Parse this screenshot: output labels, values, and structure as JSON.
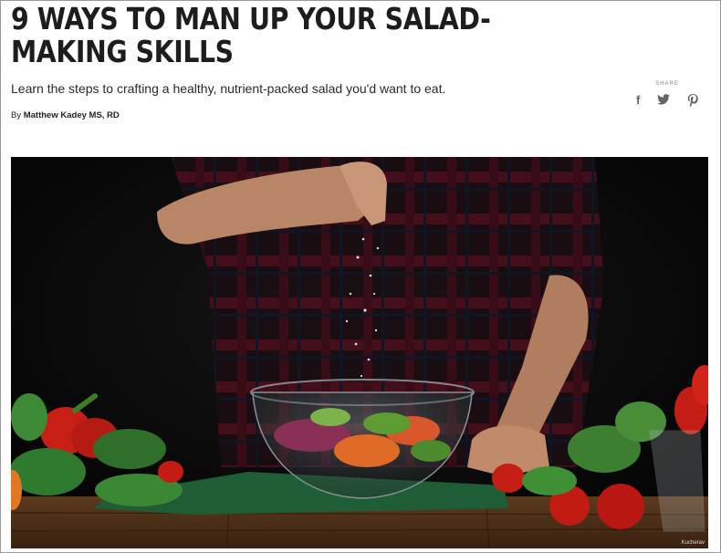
{
  "article": {
    "title": "9 WAYS TO MAN UP YOUR SALAD-MAKING SKILLS",
    "subtitle": "Learn the steps to crafting a healthy, nutrient-packed salad you'd want to eat.",
    "byline_prefix": "By",
    "author": "Matthew Kadey MS, RD"
  },
  "share": {
    "label": "SHARE",
    "icons": {
      "facebook": {
        "glyph": "f",
        "name": "facebook-icon"
      },
      "twitter": {
        "glyph": "🐦",
        "name": "twitter-icon"
      },
      "pinterest": {
        "glyph": "℗",
        "name": "pinterest-icon"
      }
    }
  },
  "hero": {
    "image_credit": "Kucherav"
  },
  "colors": {
    "title": "#1d1d1d",
    "text": "#2a2a2a",
    "icon": "#666666"
  }
}
